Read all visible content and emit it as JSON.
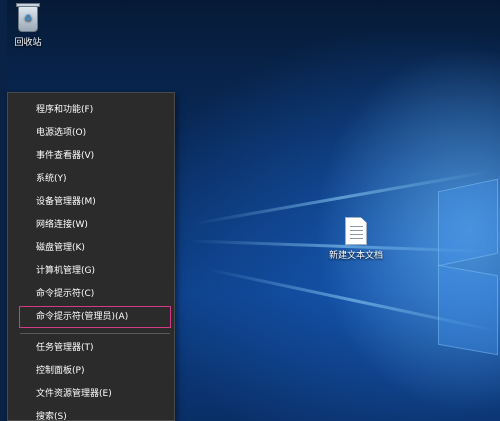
{
  "desktop": {
    "icons": [
      {
        "label": "回收站",
        "icon": "recycle-bin-icon"
      },
      {
        "label": "新建文本文档",
        "icon": "text-file-icon"
      }
    ]
  },
  "menu": {
    "items": [
      {
        "label": "程序和功能(F)"
      },
      {
        "label": "电源选项(O)"
      },
      {
        "label": "事件查看器(V)"
      },
      {
        "label": "系统(Y)"
      },
      {
        "label": "设备管理器(M)"
      },
      {
        "label": "网络连接(W)"
      },
      {
        "label": "磁盘管理(K)"
      },
      {
        "label": "计算机管理(G)"
      },
      {
        "label": "命令提示符(C)"
      },
      {
        "label": "命令提示符(管理员)(A)",
        "highlight_color": "#d43a86"
      },
      {
        "label": "任务管理器(T)"
      },
      {
        "label": "控制面板(P)"
      },
      {
        "label": "文件资源管理器(E)"
      },
      {
        "label": "搜索(S)"
      }
    ]
  }
}
